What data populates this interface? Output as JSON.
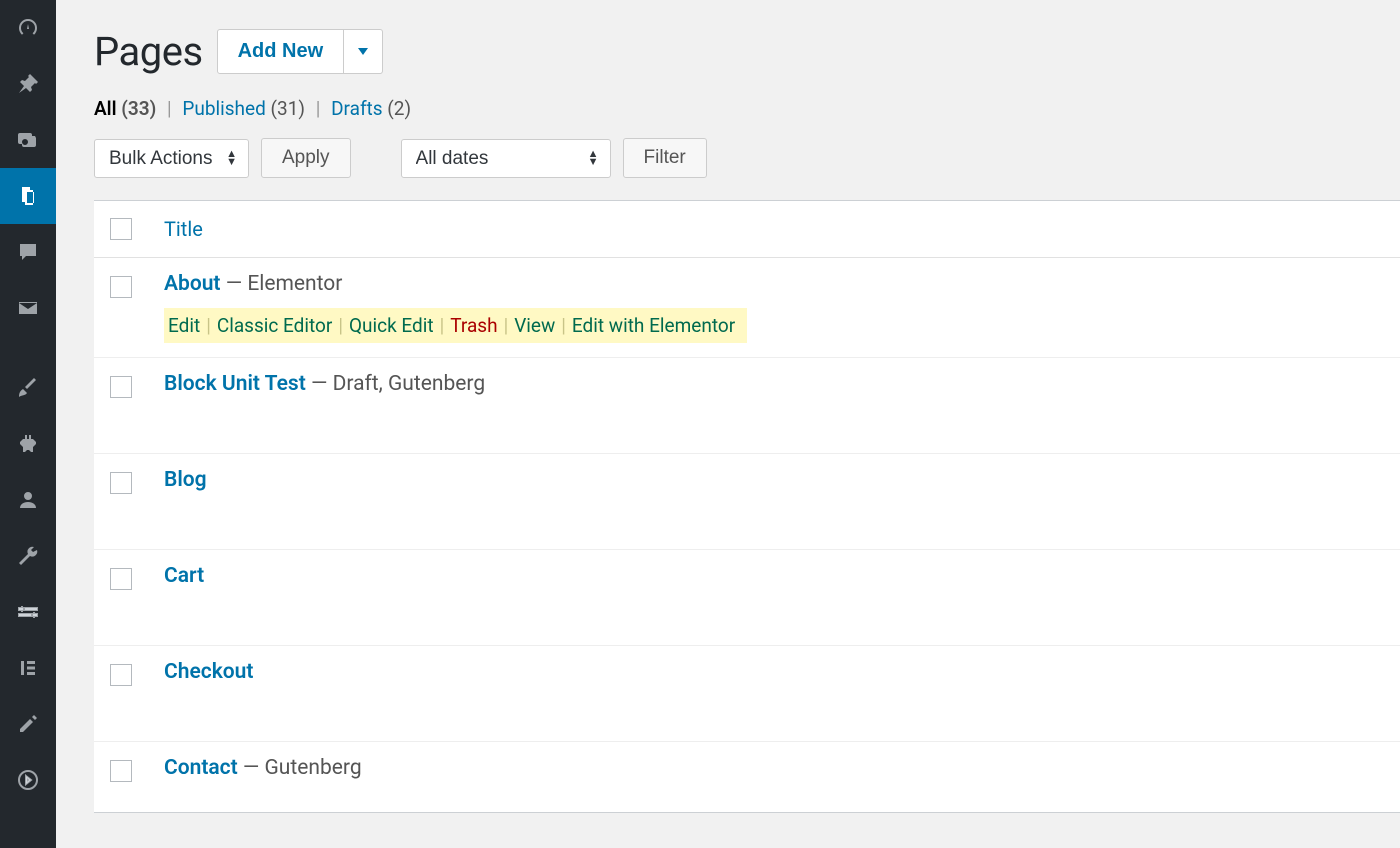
{
  "sidebar": {
    "items": [
      {
        "name": "dashboard-icon"
      },
      {
        "name": "pin-icon"
      },
      {
        "name": "media-icon"
      },
      {
        "name": "pages-icon",
        "active": true
      },
      {
        "name": "comments-icon"
      },
      {
        "name": "mail-icon"
      },
      {
        "name": "brush-icon"
      },
      {
        "name": "plugins-icon"
      },
      {
        "name": "users-icon"
      },
      {
        "name": "tools-icon"
      },
      {
        "name": "settings-icon"
      },
      {
        "name": "elementor-icon"
      },
      {
        "name": "edit-icon"
      },
      {
        "name": "collapse-icon"
      }
    ]
  },
  "header": {
    "title": "Pages",
    "add_new_label": "Add New"
  },
  "filters": {
    "all_label": "All",
    "all_count": "(33)",
    "published_label": "Published",
    "published_count": "(31)",
    "drafts_label": "Drafts",
    "drafts_count": "(2)"
  },
  "controls": {
    "bulk_actions": "Bulk Actions",
    "apply": "Apply",
    "all_dates": "All dates",
    "filter": "Filter"
  },
  "table": {
    "header_title": "Title",
    "rows": [
      {
        "title": "About",
        "meta": " — Elementor",
        "show_actions": true
      },
      {
        "title": "Block Unit Test",
        "meta": " — Draft, Gutenberg"
      },
      {
        "title": "Blog",
        "meta": ""
      },
      {
        "title": "Cart",
        "meta": ""
      },
      {
        "title": "Checkout",
        "meta": ""
      },
      {
        "title": "Contact",
        "meta": " — Gutenberg"
      }
    ],
    "actions": {
      "edit": "Edit",
      "classic": "Classic Editor",
      "quick": "Quick Edit",
      "trash": "Trash",
      "view": "View",
      "elementor": "Edit with Elementor"
    }
  }
}
